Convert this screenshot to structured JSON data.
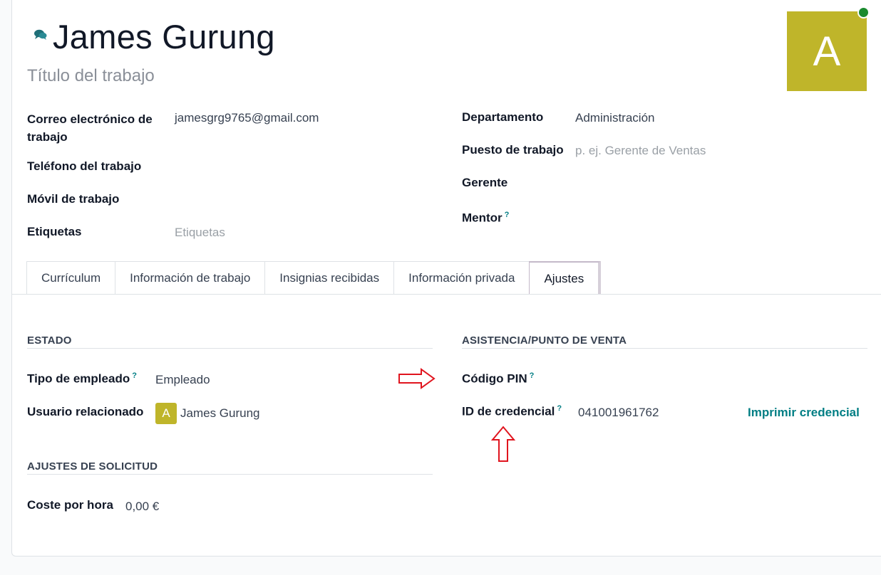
{
  "employee": {
    "name": "James Gurung",
    "job_title_placeholder": "Título del trabajo",
    "avatar_letter": "A"
  },
  "fields_left": {
    "work_email": {
      "label_line1": "Correo electrónico de",
      "label_line2": "trabajo",
      "value": "jamesgrg9765@gmail.com"
    },
    "work_phone": {
      "label": "Teléfono del trabajo",
      "value": ""
    },
    "work_mobile": {
      "label": "Móvil de trabajo",
      "value": ""
    },
    "tags": {
      "label": "Etiquetas",
      "placeholder": "Etiquetas"
    }
  },
  "fields_right": {
    "department": {
      "label": "Departamento",
      "value": "Administración"
    },
    "job_position": {
      "label": "Puesto de trabajo",
      "placeholder": "p. ej. Gerente de Ventas"
    },
    "manager": {
      "label": "Gerente",
      "value": ""
    },
    "coach": {
      "label": "Mentor",
      "help": "?"
    }
  },
  "tabs": [
    {
      "label": "Currículum"
    },
    {
      "label": "Información de trabajo"
    },
    {
      "label": "Insignias recibidas"
    },
    {
      "label": "Información privada"
    },
    {
      "label": "Ajustes",
      "active": true
    }
  ],
  "settings": {
    "status": {
      "title": "ESTADO",
      "employee_type": {
        "label": "Tipo de empleado",
        "help": "?",
        "value": "Empleado"
      },
      "related_user": {
        "label": "Usuario relacionado",
        "avatar_letter": "A",
        "value": "James Gurung"
      }
    },
    "application": {
      "title": "AJUSTES DE SOLICITUD",
      "hourly_cost": {
        "label": "Coste por hora",
        "value": "0,00 €"
      }
    },
    "attendance": {
      "title": "ASISTENCIA/PUNTO DE VENTA",
      "pin": {
        "label": "Código PIN",
        "help": "?"
      },
      "badge": {
        "label": "ID de credencial",
        "help": "?",
        "value": "041001961762",
        "print_label": "Imprimir credencial"
      }
    }
  },
  "colors": {
    "accent": "#017e84",
    "avatar": "#bfb52a",
    "status_online": "#1a8a2e",
    "annotation_arrow": "#e0141e"
  }
}
